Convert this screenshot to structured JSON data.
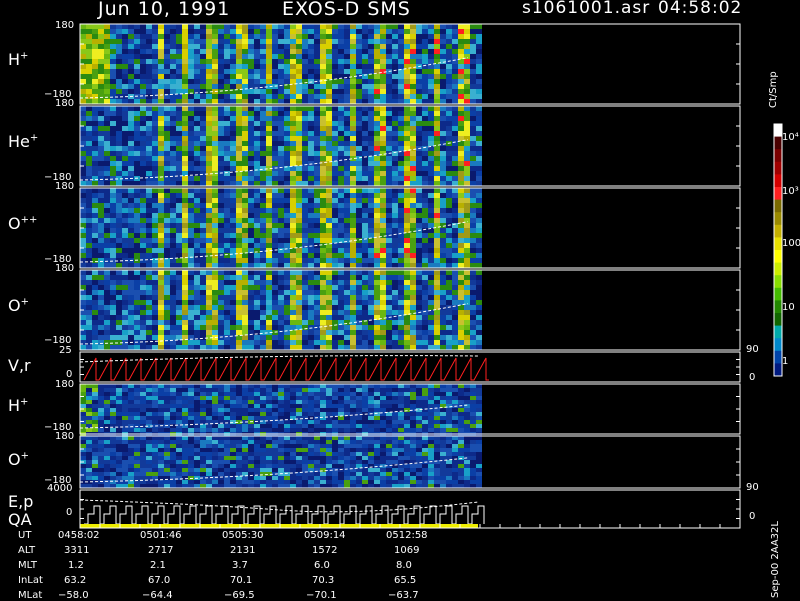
{
  "header": {
    "date": "Jun 10, 1991",
    "instrument": "EXOS-D SMS",
    "file": "s1061001.asr",
    "time": "04:58:02"
  },
  "panels": [
    {
      "ion": "H",
      "charge": "+",
      "ymax": "180",
      "ymin": "−180"
    },
    {
      "ion": "He",
      "charge": "+",
      "ymax": "180",
      "ymin": "−180"
    },
    {
      "ion": "O",
      "charge": "++",
      "ymax": "180",
      "ymin": "−180"
    },
    {
      "ion": "O",
      "charge": "+",
      "ymax": "180",
      "ymin": "−180"
    },
    {
      "ion": "V,r",
      "charge": "",
      "ymax": "25",
      "ymin": "0",
      "right_top": "90",
      "right_bottom": "0"
    },
    {
      "ion": "H",
      "charge": "+",
      "ymax": "180",
      "ymin": "−180"
    },
    {
      "ion": "O",
      "charge": "+",
      "ymax": "180",
      "ymin": "−180"
    },
    {
      "ion": "E,p",
      "ion2": "QA",
      "charge": "",
      "ymax": "4000",
      "ymin": "0",
      "right_top": "90",
      "right_bottom": "0"
    }
  ],
  "colorbar": {
    "unit": "Ct/Smp",
    "labels": [
      "10⁴",
      "10³",
      "100",
      "10",
      "1"
    ],
    "colors": [
      "#ffffff",
      "#4a0000",
      "#7a0000",
      "#a00000",
      "#d40000",
      "#ff2020",
      "#7a6a00",
      "#9a8a00",
      "#c4b000",
      "#e8e000",
      "#ffff00",
      "#ccee00",
      "#88dd00",
      "#44bb00",
      "#228800",
      "#116600",
      "#00aaaa",
      "#0088cc",
      "#0044aa",
      "#001a80"
    ]
  },
  "ephemeris": {
    "rows": [
      {
        "label": "UT",
        "values": [
          "0458:02",
          "0501:46",
          "0505:30",
          "0509:14",
          "0512:58"
        ]
      },
      {
        "label": "ALT",
        "values": [
          "3311",
          "2717",
          "2131",
          "1572",
          "1069"
        ]
      },
      {
        "label": "MLT",
        "values": [
          "1.2",
          "2.1",
          "3.7",
          "6.0",
          "8.0"
        ]
      },
      {
        "label": "InLat",
        "values": [
          "63.2",
          "67.0",
          "70.1",
          "70.3",
          "65.5"
        ]
      },
      {
        "label": "MLat",
        "values": [
          "−58.0",
          "−64.4",
          "−69.5",
          "−70.1",
          "−63.7"
        ]
      }
    ]
  },
  "footer": {
    "stamp": "Sep-00 2AA32L"
  },
  "chart_data": {
    "type": "heatmap",
    "title": "Jun 10, 1991   EXOS-D SMS",
    "x_tick_labels": [
      "0458:02",
      "0501:46",
      "0505:30",
      "0509:14",
      "0512:58"
    ],
    "xlabel": "UT",
    "series": [
      {
        "name": "H+",
        "yrange": [
          -180,
          180
        ]
      },
      {
        "name": "He+",
        "yrange": [
          -180,
          180
        ]
      },
      {
        "name": "O++",
        "yrange": [
          -180,
          180
        ]
      },
      {
        "name": "O+",
        "yrange": [
          -180,
          180
        ]
      },
      {
        "name": "V,r",
        "yrange": [
          0,
          25
        ]
      },
      {
        "name": "H+",
        "yrange": [
          -180,
          180
        ]
      },
      {
        "name": "O+",
        "yrange": [
          -180,
          180
        ]
      },
      {
        "name": "E,p",
        "yrange": [
          0,
          4000
        ]
      }
    ],
    "colorscale": {
      "label": "Ct/Smp",
      "range": [
        1,
        10000
      ],
      "log": true
    }
  }
}
